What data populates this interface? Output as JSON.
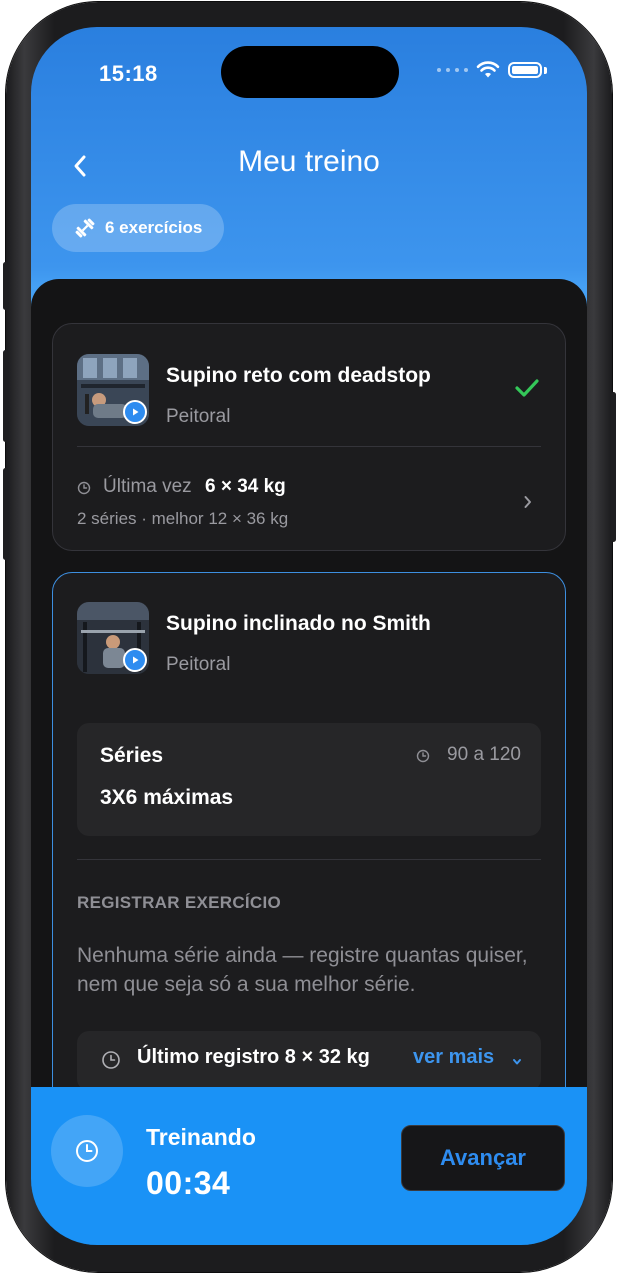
{
  "status_bar": {
    "time": "15:18"
  },
  "header": {
    "title": "Meu treino"
  },
  "pill": {
    "label": "6 exercícios"
  },
  "exercises": [
    {
      "name": "Supino reto com deadstop",
      "group": "Peitoral",
      "completed": true,
      "last_time_label": "Última vez",
      "last_time_value": "6 × 34 kg",
      "summary": "2 séries · melhor 12 × 36 kg"
    },
    {
      "name": "Supino inclinado no Smith",
      "group": "Peitoral",
      "series_label": "Séries",
      "series_rest": "90 a 120",
      "series_value": "3X6 máximas",
      "register_heading": "REGISTRAR EXERCÍCIO",
      "register_hint": "Nenhuma série ainda — registre quantas quiser, nem que seja só a sua melhor série.",
      "last_record": "Último registro 8 × 32 kg",
      "see_more": "ver mais"
    }
  ],
  "bottom_bar": {
    "status_label": "Treinando",
    "elapsed": "00:34",
    "advance_label": "Avançar"
  },
  "colors": {
    "accent": "#2e8cf0",
    "header_top": "#2a7fdf",
    "bottom_bar": "#1a92f6",
    "sheet": "#141415",
    "card": "#1c1c1e",
    "success": "#34c759"
  }
}
